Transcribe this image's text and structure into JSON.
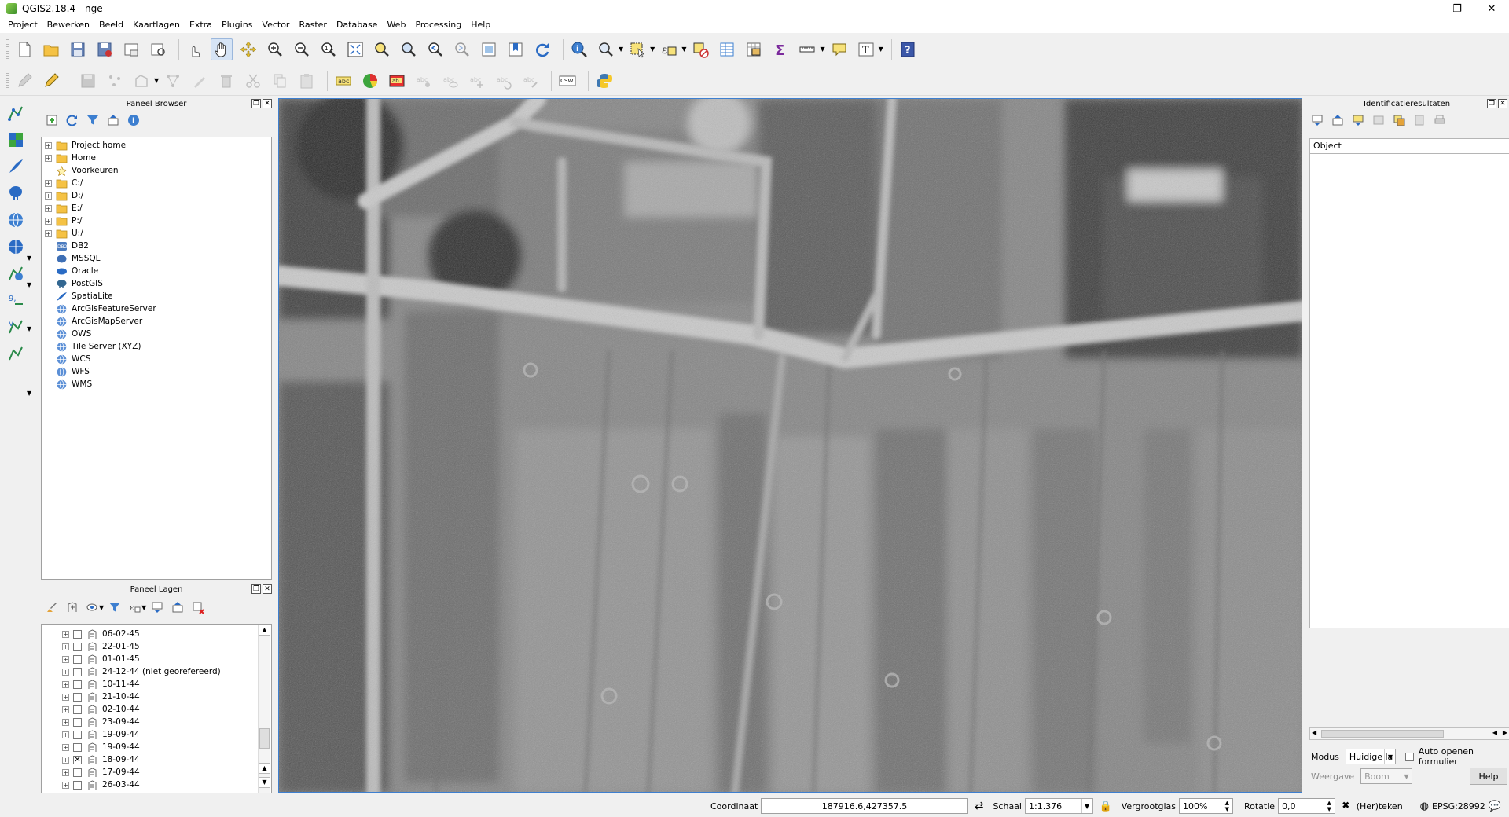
{
  "window": {
    "title": "QGIS2.18.4 - nge",
    "minimize": "–",
    "restore": "❐",
    "close": "✕"
  },
  "menu": [
    "Project",
    "Bewerken",
    "Beeld",
    "Kaartlagen",
    "Extra",
    "Plugins",
    "Vector",
    "Raster",
    "Database",
    "Web",
    "Processing",
    "Help"
  ],
  "toolbar2": {
    "csw_label": "CSW"
  },
  "browser_panel": {
    "title": "Paneel Browser",
    "items": [
      {
        "label": "Project home",
        "icon": "folder-icon",
        "expandable": true
      },
      {
        "label": "Home",
        "icon": "folder-icon",
        "expandable": true
      },
      {
        "label": "Voorkeuren",
        "icon": "star-icon",
        "expandable": false
      },
      {
        "label": "C:/",
        "icon": "folder-icon",
        "expandable": true
      },
      {
        "label": "D:/",
        "icon": "folder-icon",
        "expandable": true
      },
      {
        "label": "E:/",
        "icon": "folder-icon",
        "expandable": true
      },
      {
        "label": "P:/",
        "icon": "folder-icon",
        "expandable": true
      },
      {
        "label": "U:/",
        "icon": "folder-icon",
        "expandable": true
      },
      {
        "label": "DB2",
        "icon": "db2-icon",
        "expandable": false
      },
      {
        "label": "MSSQL",
        "icon": "mssql-icon",
        "expandable": false
      },
      {
        "label": "Oracle",
        "icon": "oracle-icon",
        "expandable": false
      },
      {
        "label": "PostGIS",
        "icon": "postgis-icon",
        "expandable": false
      },
      {
        "label": "SpatiaLite",
        "icon": "spatialite-icon",
        "expandable": false
      },
      {
        "label": "ArcGisFeatureServer",
        "icon": "globe-icon",
        "expandable": false
      },
      {
        "label": "ArcGisMapServer",
        "icon": "globe-icon",
        "expandable": false
      },
      {
        "label": "OWS",
        "icon": "globe-icon",
        "expandable": false
      },
      {
        "label": "Tile Server (XYZ)",
        "icon": "globe-icon",
        "expandable": false
      },
      {
        "label": "WCS",
        "icon": "globe-icon",
        "expandable": false
      },
      {
        "label": "WFS",
        "icon": "globe-icon",
        "expandable": false
      },
      {
        "label": "WMS",
        "icon": "globe-icon",
        "expandable": false
      }
    ]
  },
  "layers_panel": {
    "title": "Paneel Lagen",
    "layers": [
      {
        "label": "06-02-45",
        "checked": false
      },
      {
        "label": "22-01-45",
        "checked": false
      },
      {
        "label": "01-01-45",
        "checked": false
      },
      {
        "label": "24-12-44 (niet georefereerd)",
        "checked": false
      },
      {
        "label": "10-11-44",
        "checked": false
      },
      {
        "label": "21-10-44",
        "checked": false
      },
      {
        "label": "02-10-44",
        "checked": false
      },
      {
        "label": "23-09-44",
        "checked": false
      },
      {
        "label": "19-09-44",
        "checked": false
      },
      {
        "label": "19-09-44",
        "checked": false
      },
      {
        "label": "18-09-44",
        "checked": true
      },
      {
        "label": "17-09-44",
        "checked": false
      },
      {
        "label": "26-03-44",
        "checked": false
      }
    ]
  },
  "ident_panel": {
    "title": "Identificatieresultaten",
    "column_header": "Object",
    "modus_label": "Modus",
    "modus_value": "Huidige la",
    "auto_open_label": "Auto openen formulier",
    "weergave_label": "Weergave",
    "weergave_value": "Boom",
    "help_label": "Help"
  },
  "statusbar": {
    "coord_label": "Coordinaat",
    "coord_value": "187916.6,427357.5",
    "scale_label": "Schaal",
    "scale_value": "1:1.376",
    "magnifier_label": "Vergrootglas",
    "magnifier_value": "100%",
    "rotation_label": "Rotatie",
    "rotation_value": "0,0",
    "render_label": "(Her)teken",
    "crs_label": "EPSG:28992"
  }
}
